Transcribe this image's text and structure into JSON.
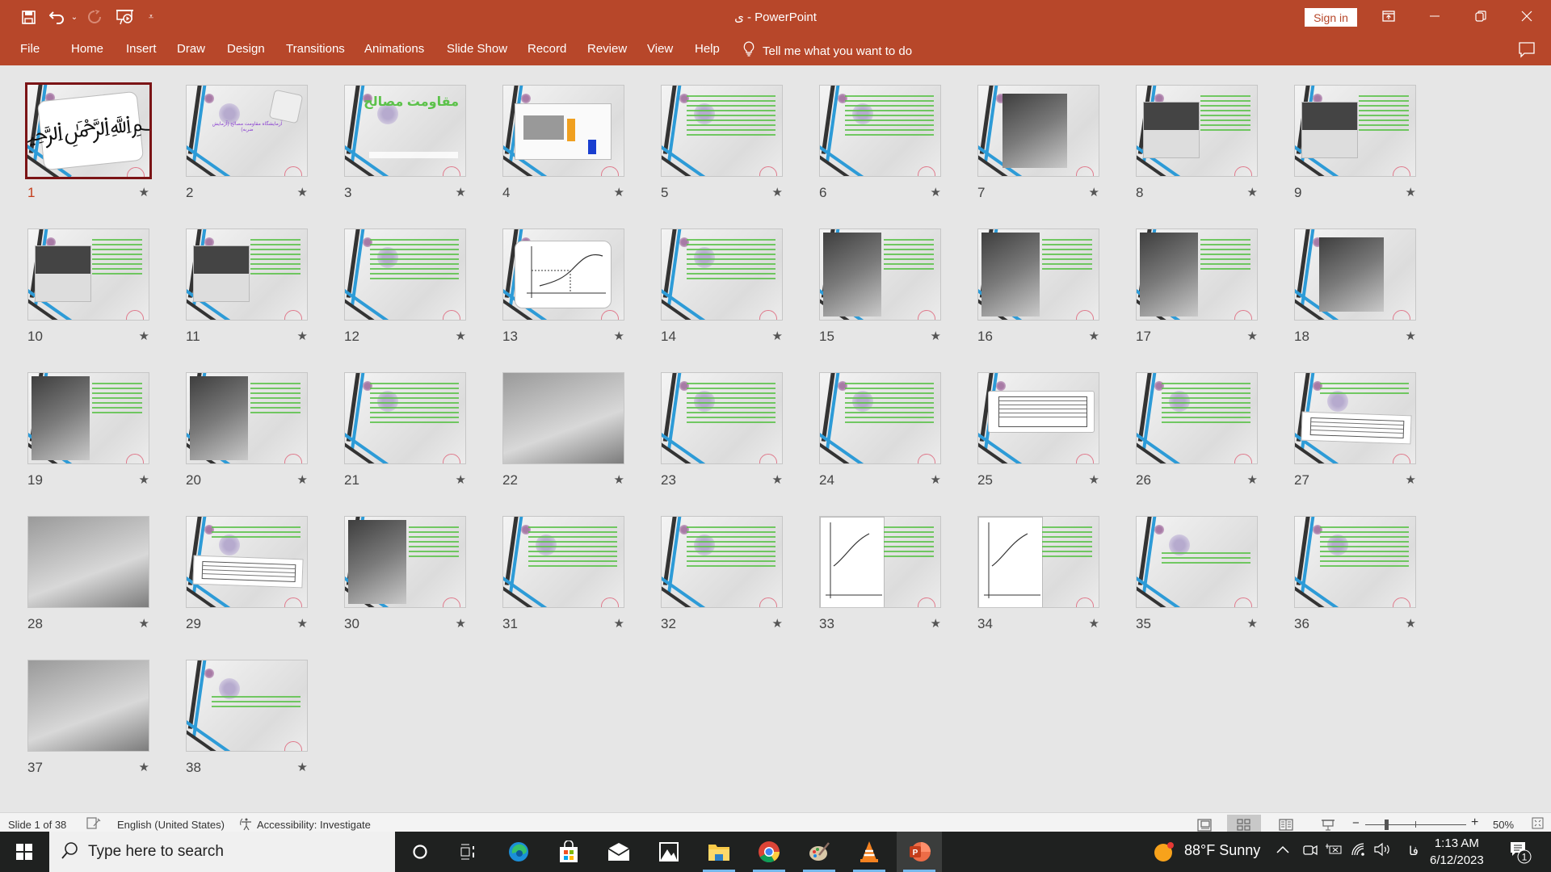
{
  "app": {
    "title": "ی  -  PowerPoint",
    "sign_in": "Sign in",
    "window_controls": [
      "ribbon-display-icon",
      "minimize-icon",
      "restore-icon",
      "close-icon"
    ]
  },
  "quick_access": {
    "items": [
      "save-icon",
      "undo-icon",
      "undo-dropdown-icon",
      "redo-icon",
      "start-from-beginning-icon",
      "customize-qat-icon"
    ]
  },
  "menu": {
    "tabs": [
      "File",
      "Home",
      "Insert",
      "Draw",
      "Design",
      "Transitions",
      "Animations",
      "Slide Show",
      "Record",
      "Review",
      "View",
      "Help"
    ],
    "tell_me": "Tell me what you want to do"
  },
  "sorter": {
    "selected_slide": 1,
    "slides": [
      {
        "n": "1",
        "kind": "calligraphy"
      },
      {
        "n": "2",
        "kind": "title-logo",
        "text": "آزمایشگاه مقاومت مصالح (آزمایش ضربه)"
      },
      {
        "n": "3",
        "kind": "title",
        "text": "مقاومت مصالح"
      },
      {
        "n": "4",
        "kind": "diagram"
      },
      {
        "n": "5",
        "kind": "text"
      },
      {
        "n": "6",
        "kind": "text"
      },
      {
        "n": "7",
        "kind": "photo-center"
      },
      {
        "n": "8",
        "kind": "image-text"
      },
      {
        "n": "9",
        "kind": "image-text"
      },
      {
        "n": "10",
        "kind": "image-text"
      },
      {
        "n": "11",
        "kind": "image-text"
      },
      {
        "n": "12",
        "kind": "text"
      },
      {
        "n": "13",
        "kind": "chart"
      },
      {
        "n": "14",
        "kind": "text"
      },
      {
        "n": "15",
        "kind": "photo-text"
      },
      {
        "n": "16",
        "kind": "photo-text"
      },
      {
        "n": "17",
        "kind": "photo-text"
      },
      {
        "n": "18",
        "kind": "photo-center"
      },
      {
        "n": "19",
        "kind": "photo-text"
      },
      {
        "n": "20",
        "kind": "photo-text"
      },
      {
        "n": "21",
        "kind": "text"
      },
      {
        "n": "22",
        "kind": "photo-full"
      },
      {
        "n": "23",
        "kind": "text"
      },
      {
        "n": "24",
        "kind": "text"
      },
      {
        "n": "25",
        "kind": "table"
      },
      {
        "n": "26",
        "kind": "text"
      },
      {
        "n": "27",
        "kind": "table-text"
      },
      {
        "n": "28",
        "kind": "photo-full"
      },
      {
        "n": "29",
        "kind": "table-text"
      },
      {
        "n": "30",
        "kind": "photo-text"
      },
      {
        "n": "31",
        "kind": "text"
      },
      {
        "n": "32",
        "kind": "text"
      },
      {
        "n": "33",
        "kind": "chart-text"
      },
      {
        "n": "34",
        "kind": "chart-text"
      },
      {
        "n": "35",
        "kind": "text-short"
      },
      {
        "n": "36",
        "kind": "text"
      },
      {
        "n": "37",
        "kind": "photo-full"
      },
      {
        "n": "38",
        "kind": "text-short"
      }
    ]
  },
  "status": {
    "slide_info": "Slide 1 of 38",
    "language": "English (United States)",
    "accessibility": "Accessibility: Investigate",
    "zoom": "50%",
    "zoom_minus": "−",
    "zoom_plus": "+"
  },
  "taskbar": {
    "search_placeholder": "Type here to search",
    "apps": [
      "cortana-icon",
      "task-view-icon",
      "edge-icon",
      "store-icon",
      "mail-icon",
      "photos-icon",
      "file-explorer-icon",
      "chrome-icon",
      "paint-icon",
      "vlc-icon",
      "powerpoint-icon"
    ],
    "weather": "88°F  Sunny",
    "lang_indicator": "فا",
    "time": "1:13 AM",
    "date": "6/12/2023",
    "notifications": "1"
  },
  "colors": {
    "accent": "#b7472a",
    "selected_border": "#7b1416",
    "slide_text_green": "#5cc24a",
    "theme_blue": "#2d9bd7"
  }
}
